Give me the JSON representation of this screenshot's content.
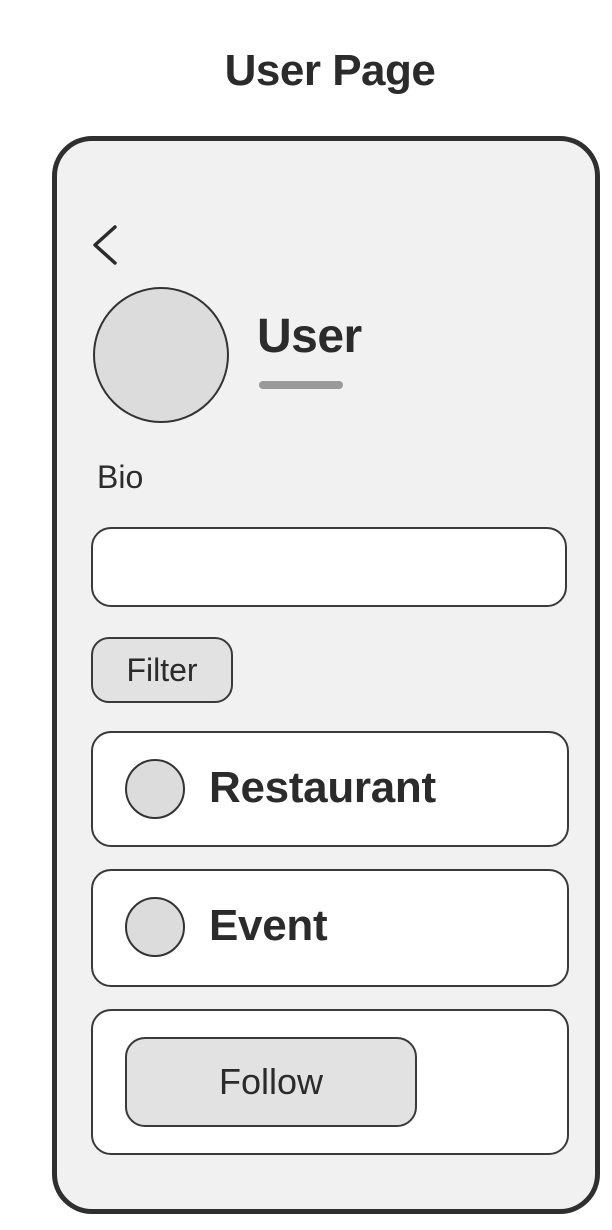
{
  "page": {
    "title": "User Page"
  },
  "header": {
    "back_icon": "chevron-left-icon"
  },
  "profile": {
    "username": "User",
    "bio_label": "Bio",
    "bio_value": "",
    "bio_placeholder": ""
  },
  "filter": {
    "label": "Filter"
  },
  "cards": [
    {
      "label": "Restaurant"
    },
    {
      "label": "Event"
    }
  ],
  "actions": {
    "follow_label": "Follow"
  },
  "colors": {
    "frame_border": "#2f2f2f",
    "frame_background": "#f1f1f1",
    "card_background": "#ffffff",
    "avatar_fill": "#dcdcdc",
    "button_fill": "#e2e2e2",
    "underline": "#9a9a9a"
  }
}
